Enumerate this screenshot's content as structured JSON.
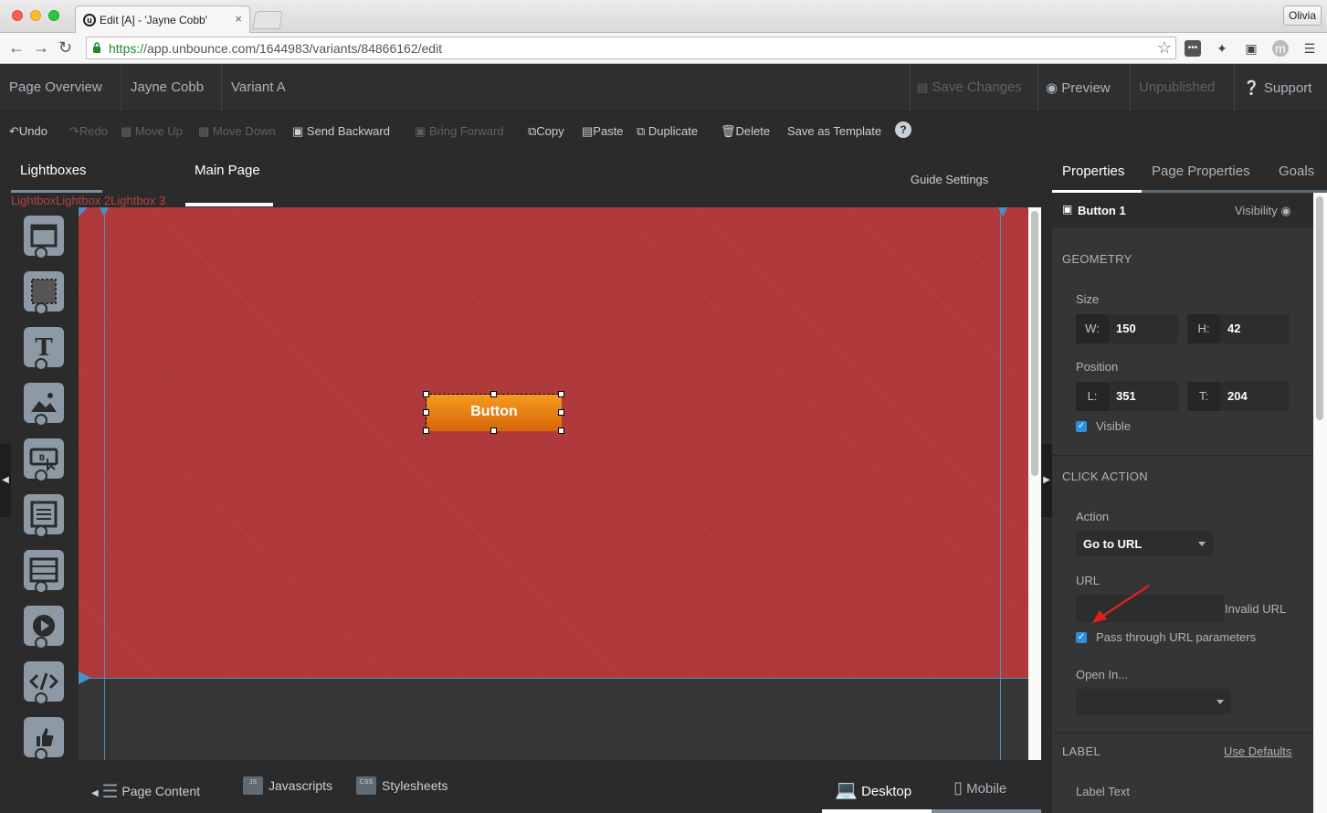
{
  "browser": {
    "tab_title": "Edit [A] - 'Jayne Cobb'",
    "tab_close": "×",
    "user_button": "Olivia",
    "url_scheme": "https://",
    "url_rest": "app.unbounce.com/1644983/variants/84866162/edit"
  },
  "appbar": {
    "page_overview": "Page Overview",
    "page_name": "Jayne Cobb",
    "variant": "Variant A",
    "save_changes": "Save Changes",
    "preview": "Preview",
    "unpublished": "Unpublished",
    "support": "Support"
  },
  "toolbar": {
    "undo": "Undo",
    "redo": "Redo",
    "move_up": "Move Up",
    "move_down": "Move Down",
    "send_backward": "Send Backward",
    "bring_forward": "Bring Forward",
    "copy": "Copy",
    "paste": "Paste",
    "duplicate": "Duplicate",
    "delete": "Delete",
    "save_as_template": "Save as Template",
    "help": "?"
  },
  "editor": {
    "tab_lightboxes": "Lightboxes",
    "tab_main_page": "Main Page",
    "lightbox_labels": "LightboxLightbox 2Lightbox 3",
    "guide_settings": "Guide Settings",
    "canvas_button": "Button"
  },
  "palette": {
    "items": [
      "section",
      "box",
      "text",
      "image",
      "button",
      "form",
      "social-widget",
      "video",
      "custom-html",
      "social"
    ]
  },
  "bottombar": {
    "page_content": "Page Content",
    "javascripts": "Javascripts",
    "stylesheets": "Stylesheets",
    "js_icon": "JS",
    "css_icon": "CSS",
    "desktop": "Desktop",
    "mobile": "Mobile"
  },
  "properties": {
    "tab_properties": "Properties",
    "tab_page_properties": "Page Properties",
    "tab_goals": "Goals",
    "element_name": "Button 1",
    "visibility": "Visibility",
    "geometry_title": "GEOMETRY",
    "size_label": "Size",
    "w_prefix": "W:",
    "w_value": "150",
    "h_prefix": "H:",
    "h_value": "42",
    "position_label": "Position",
    "l_prefix": "L:",
    "l_value": "351",
    "t_prefix": "T:",
    "t_value": "204",
    "visible_label": "Visible",
    "click_action_title": "CLICK ACTION",
    "action_label": "Action",
    "action_value": "Go to URL",
    "url_label": "URL",
    "url_value": "",
    "invalid_url": "Invalid URL",
    "pass_through_label": "Pass through URL parameters",
    "open_in_label": "Open In...",
    "open_in_value": "",
    "label_title": "LABEL",
    "use_defaults": "Use Defaults",
    "label_text": "Label Text"
  },
  "colors": {
    "canvas_red": "#b0393b",
    "button_orange": "#e97e12",
    "accent_blue": "#2d8fdc",
    "annotation_arrow": "#e02020"
  }
}
